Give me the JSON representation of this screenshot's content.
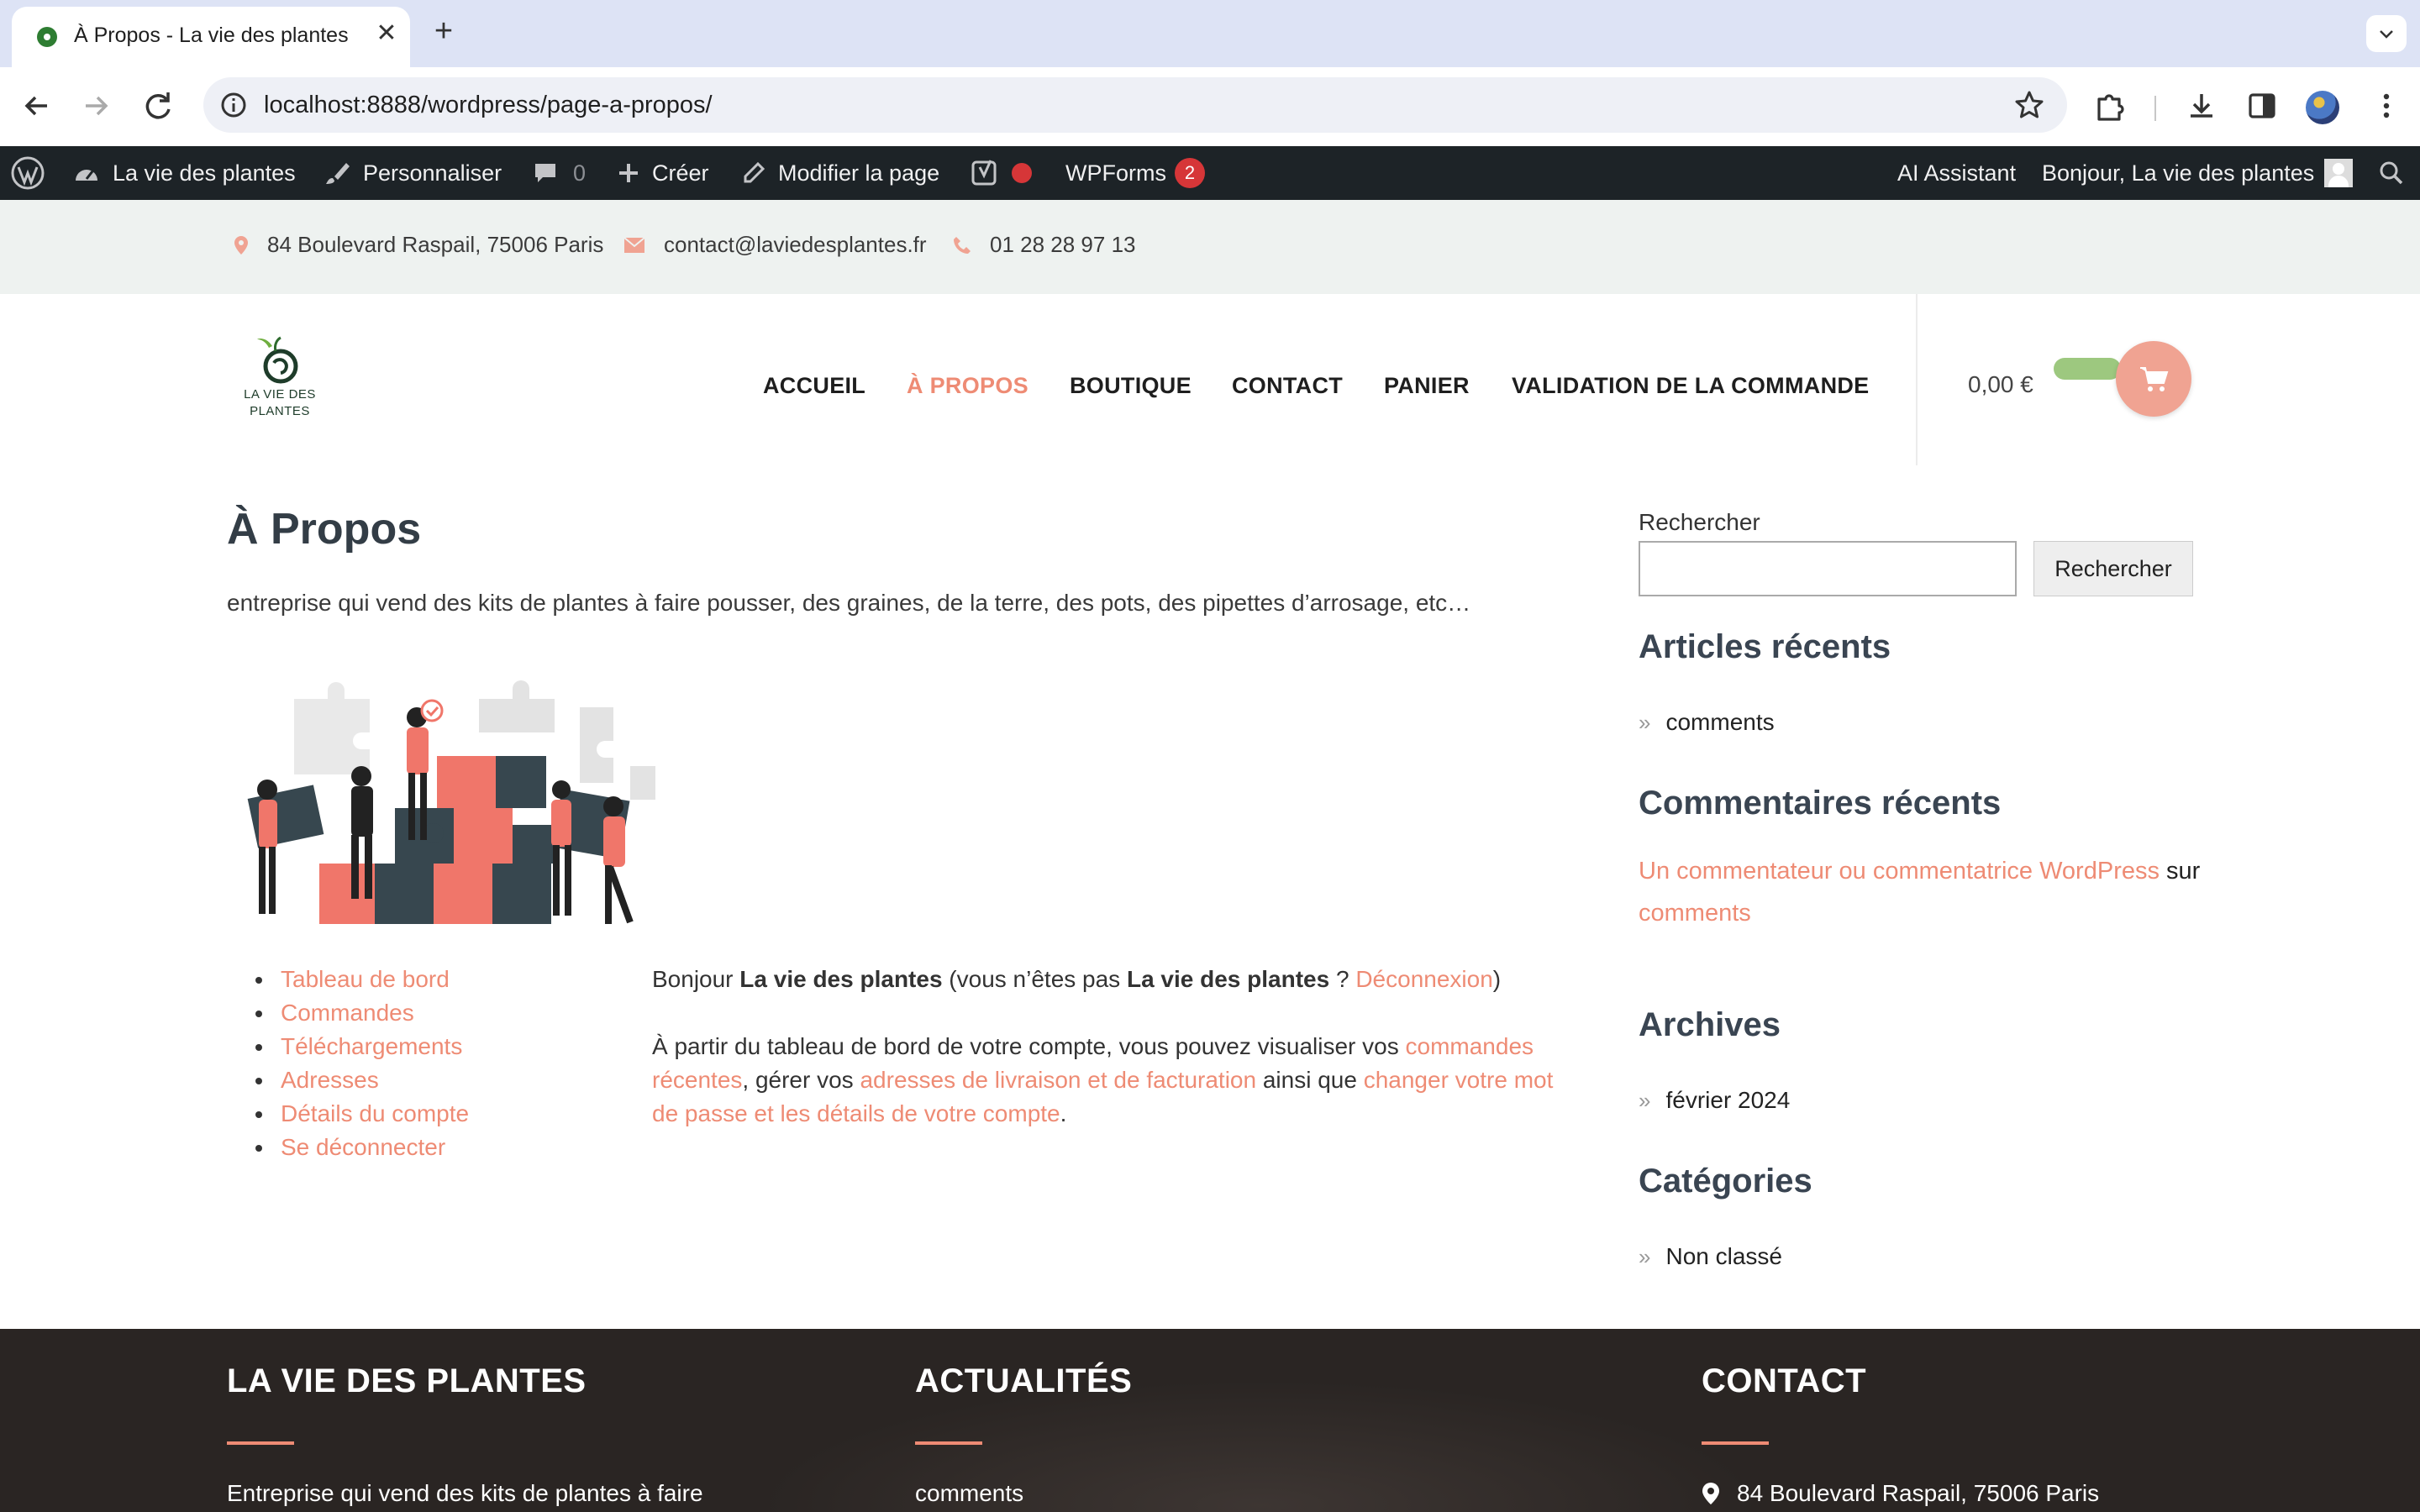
{
  "browser": {
    "tab_title": "À Propos - La vie des plantes",
    "url": "localhost:8888/wordpress/page-a-propos/"
  },
  "adminbar": {
    "site_name": "La vie des plantes",
    "customize": "Personnaliser",
    "comments_count": "0",
    "new": "Créer",
    "edit_page": "Modifier la page",
    "wpforms": "WPForms",
    "wpforms_badge": "2",
    "ai_assistant": "AI Assistant",
    "greeting": "Bonjour, La vie des plantes"
  },
  "topbar": {
    "address": "84 Boulevard Raspail, 75006 Paris",
    "email": "contact@laviedesplantes.fr",
    "phone": "01 28 28 97 13"
  },
  "header": {
    "logo_line1": "LA VIE DES",
    "logo_line2": "PLANTES",
    "menu": [
      "ACCUEIL",
      "À PROPOS",
      "BOUTIQUE",
      "CONTACT",
      "PANIER",
      "VALIDATION DE LA COMMANDE"
    ],
    "active_menu": "À PROPOS",
    "cart_total": "0,00 €",
    "accent_color": "#ee8b74"
  },
  "main": {
    "title": "À Propos",
    "intro": "entreprise qui vend des kits de plantes à faire pousser, des graines, de la terre, des pots, des pipettes d’arrosage, etc…",
    "account_nav": [
      "Tableau de bord",
      "Commandes",
      "Téléchargements",
      "Adresses",
      "Détails du compte",
      "Se déconnecter"
    ],
    "greeting_pre": "Bonjour ",
    "user_name": "La vie des plantes",
    "greeting_mid": " (vous n’êtes pas ",
    "greeting_q": " ? ",
    "logout_link": "Déconnexion",
    "greeting_end": ")",
    "dashboard_pre": "À partir du tableau de bord de votre compte, vous pouvez visualiser vos ",
    "orders_link": "commandes récentes",
    "dashboard_mid1": ", gérer vos ",
    "addresses_link": "adresses de livraison et de facturation",
    "dashboard_mid2": " ainsi que ",
    "password_link": "changer votre mot de passe et les détails de votre compte",
    "dashboard_end": "."
  },
  "sidebar": {
    "search_label": "Rechercher",
    "search_button": "Rechercher",
    "recent_posts_title": "Articles récents",
    "recent_posts": [
      "comments"
    ],
    "recent_comments_title": "Commentaires récents",
    "comment_author": "Un commentateur ou commentatrice WordPress",
    "comment_on": " sur ",
    "comment_post": "comments",
    "archives_title": "Archives",
    "archives": [
      "février 2024"
    ],
    "categories_title": "Catégories",
    "categories": [
      "Non classé"
    ]
  },
  "footer": {
    "col1_title": "LA VIE DES PLANTES",
    "col1_text": "Entreprise qui vend des kits de plantes à faire",
    "col2_title": "ACTUALITÉS",
    "col2_text": "comments",
    "col3_title": "CONTACT",
    "col3_text": "84 Boulevard Raspail, 75006 Paris"
  }
}
